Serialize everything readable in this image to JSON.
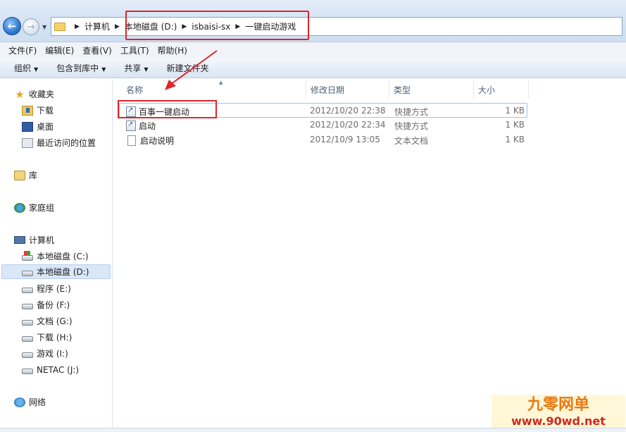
{
  "address": {
    "crumbs": [
      "计算机",
      "本地磁盘 (D:)",
      "isbaisi-sx",
      "一键启动游戏"
    ]
  },
  "menu": [
    "文件(F)",
    "编辑(E)",
    "查看(V)",
    "工具(T)",
    "帮助(H)"
  ],
  "toolbar": {
    "organize": "组织",
    "include_library": "包含到库中",
    "share": "共享",
    "new_folder": "新建文件夹"
  },
  "nav": {
    "favorites": "收藏夹",
    "downloads": "下载",
    "desktop": "桌面",
    "recent": "最近访问的位置",
    "libraries": "库",
    "homegroup": "家庭组",
    "computer": "计算机",
    "drives": [
      "本地磁盘 (C:)",
      "本地磁盘 (D:)",
      "程序 (E:)",
      "备份 (F:)",
      "文档 (G:)",
      "下载 (H:)",
      "游戏 (I:)",
      "NETAC (J:)"
    ],
    "network": "网络"
  },
  "columns": {
    "name": "名称",
    "date": "修改日期",
    "type": "类型",
    "size": "大小"
  },
  "files": [
    {
      "name": "百事一键启动",
      "date": "2012/10/20 22:38",
      "type": "快捷方式",
      "size": "1 KB"
    },
    {
      "name": "启动",
      "date": "2012/10/20 22:34",
      "type": "快捷方式",
      "size": "1 KB"
    },
    {
      "name": "启动说明",
      "date": "2012/10/9 13:05",
      "type": "文本文档",
      "size": "1 KB"
    }
  ],
  "watermark": {
    "line1": "九零网单",
    "line2": "www.90wd.net"
  },
  "colors": {
    "highlight": "#e0252b",
    "accent": "#2f7ad1"
  }
}
